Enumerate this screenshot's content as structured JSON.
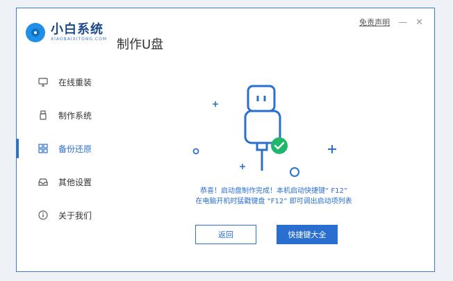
{
  "brand": {
    "name": "小白系统",
    "subtitle": "XIAOBAIXITONG.COM"
  },
  "page_title": "制作U盘",
  "window_controls": {
    "disclaimer": "免责声明",
    "minimize": "—",
    "close": "✕"
  },
  "sidebar": {
    "items": [
      {
        "label": "在线重装",
        "icon": "monitor-icon",
        "active": false
      },
      {
        "label": "制作系统",
        "icon": "usb-icon",
        "active": false
      },
      {
        "label": "备份还原",
        "icon": "grid-icon",
        "active": true
      },
      {
        "label": "其他设置",
        "icon": "tray-icon",
        "active": false
      },
      {
        "label": "关于我们",
        "icon": "info-icon",
        "active": false
      }
    ]
  },
  "message": {
    "line1": "恭喜！启动盘制作完成！本机启动快捷键“ F12”",
    "line2": "在电脑开机时猛戳键盘 “F12” 即可调出启动项列表"
  },
  "buttons": {
    "back": "返回",
    "shortcut_keys": "快捷键大全"
  },
  "colors": {
    "accent": "#2a6fcf",
    "success": "#1fb86a",
    "brand_dark": "#1e4a8c"
  }
}
